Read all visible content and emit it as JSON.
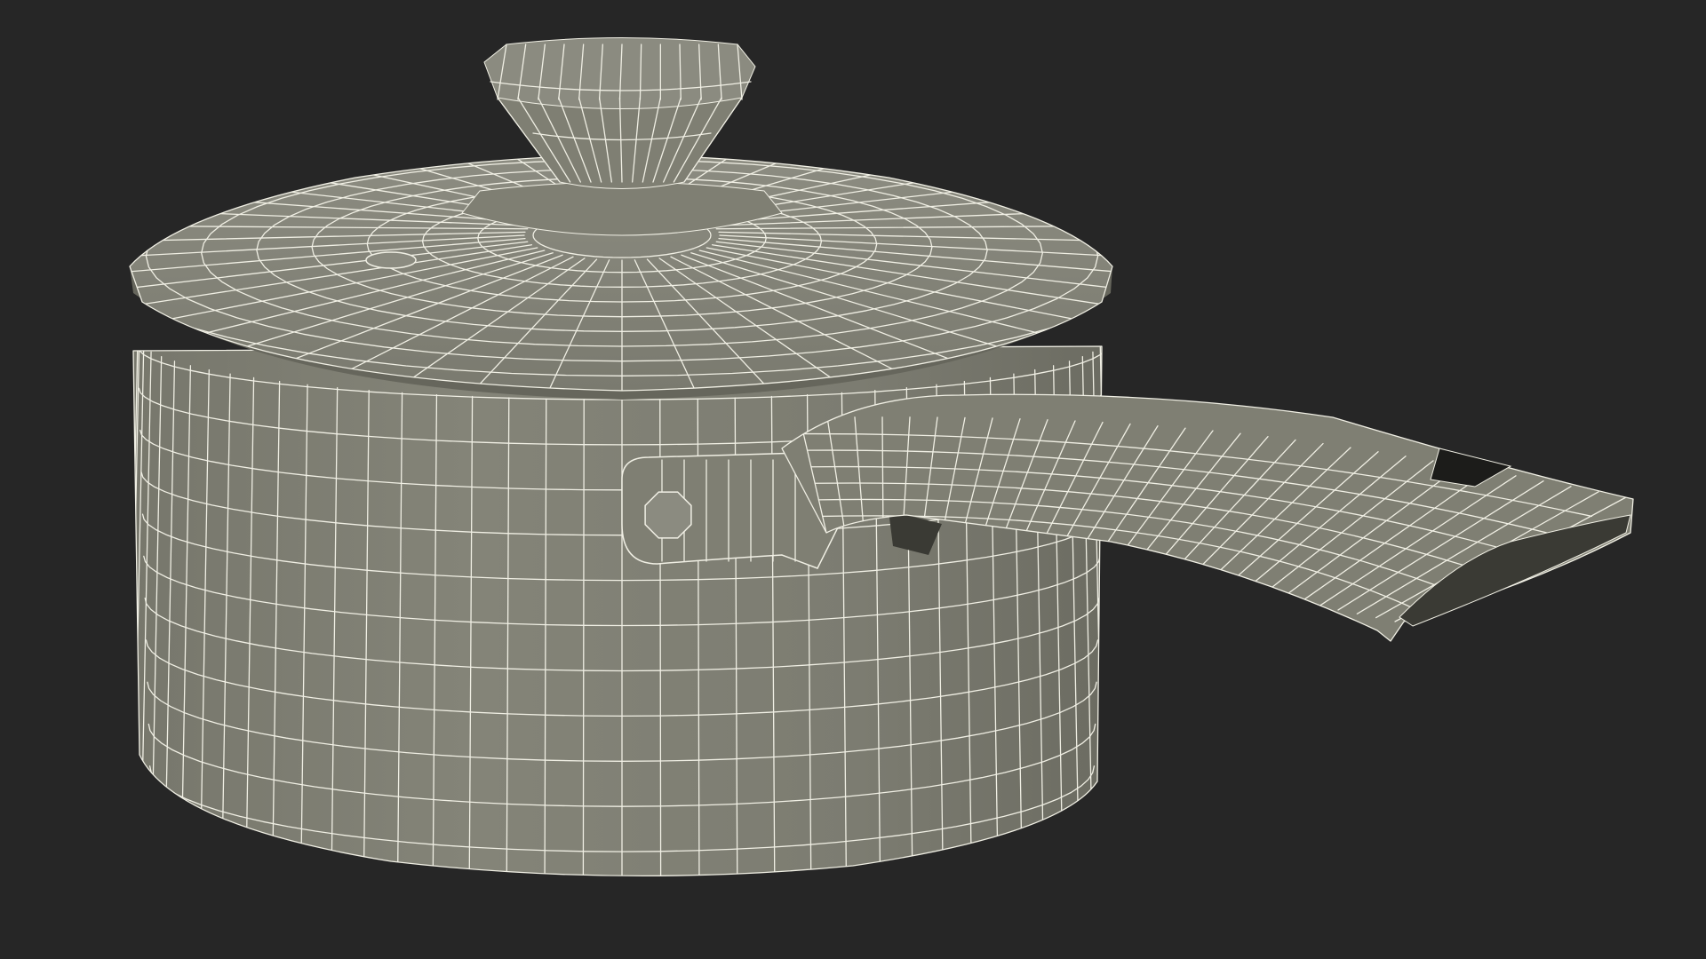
{
  "colors": {
    "background": "#262626",
    "surface": "#7f7f73",
    "surface_light": "#8b8b80",
    "surface_dark": "#66665c",
    "wire": "#f0efe4",
    "shadow": "#3a3a34",
    "hole": "#1c1c1a"
  }
}
